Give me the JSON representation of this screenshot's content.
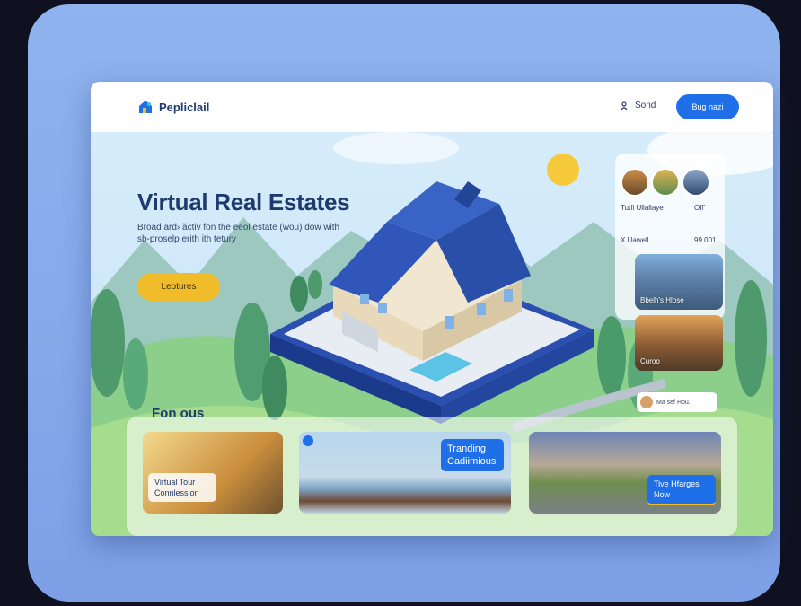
{
  "brand": {
    "name": "Pepliclail"
  },
  "nav": {
    "signin_label": "Sond",
    "buy_label": "Bug nazi"
  },
  "hero": {
    "title": "Virtual Real Estates",
    "subtitle": "Broad ard› ǎctiv fon the eeol estate (wou) dow with sb-proselp erith ith tetury",
    "cta_label": "Leotures"
  },
  "side_panel": {
    "avatars_caption": "Tutfi Ullallaye",
    "avatars_off": "Off'",
    "list_label": "X Uawell",
    "list_value": "99.001",
    "thumb1_label": "Bbelh's Hlose",
    "thumb2_label": "Curoo",
    "chat_text": "Ma sef Hou."
  },
  "featured": {
    "title": "Fon ous",
    "cards": [
      {
        "label": "Virtual Tour Connlession"
      },
      {
        "label": "Tranding Cadiimious"
      },
      {
        "label": "Tive Hfarges Now"
      }
    ]
  },
  "colors": {
    "accent": "#1f6fe8",
    "cta": "#f1bc2a",
    "title": "#1e3a6e"
  }
}
